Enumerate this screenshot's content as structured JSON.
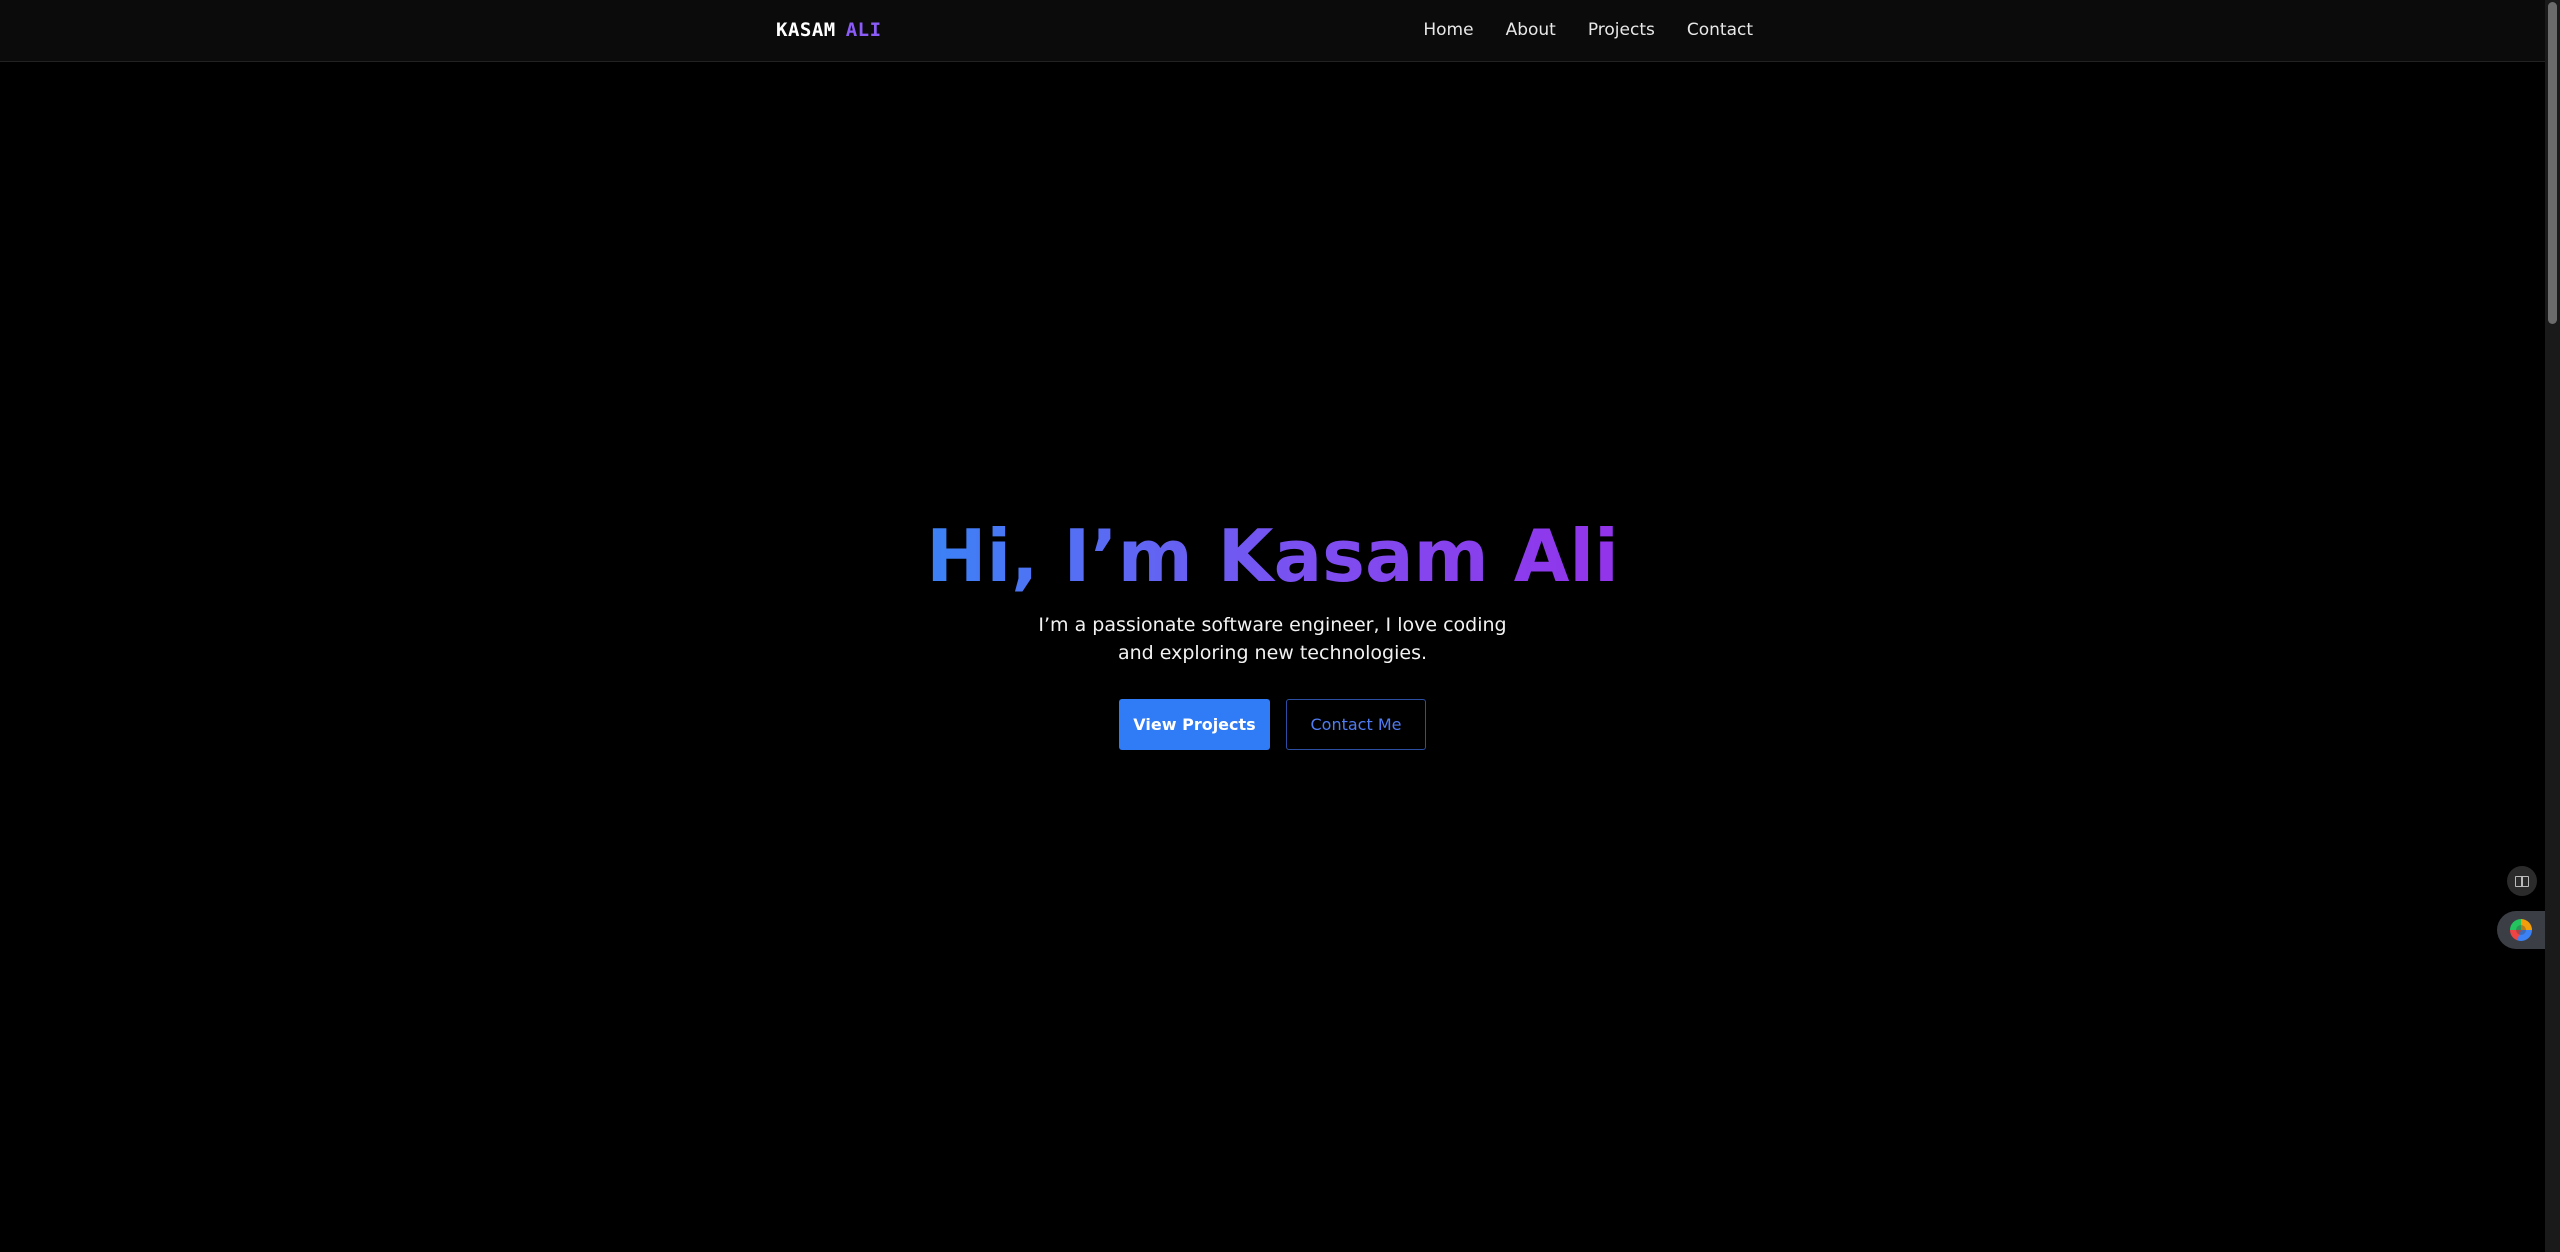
{
  "nav": {
    "logo_first": "KASAM",
    "logo_second": "ALI",
    "links": [
      "Home",
      "About",
      "Projects",
      "Contact"
    ]
  },
  "hero": {
    "title": "Hi, I’m Kasam Ali",
    "subtitle": "I’m a passionate software engineer, I love coding and exploring new technologies.",
    "primary_button": "View Projects",
    "secondary_button": "Contact Me"
  },
  "side_widgets": {
    "top_icon": "book-icon",
    "bottom_icon": "globe-icon"
  },
  "colors": {
    "background": "#000000",
    "accent_purple": "#8b5cf6",
    "accent_blue": "#2f7cf6",
    "gradient_start": "#3b82f6",
    "gradient_end": "#9333ea"
  }
}
